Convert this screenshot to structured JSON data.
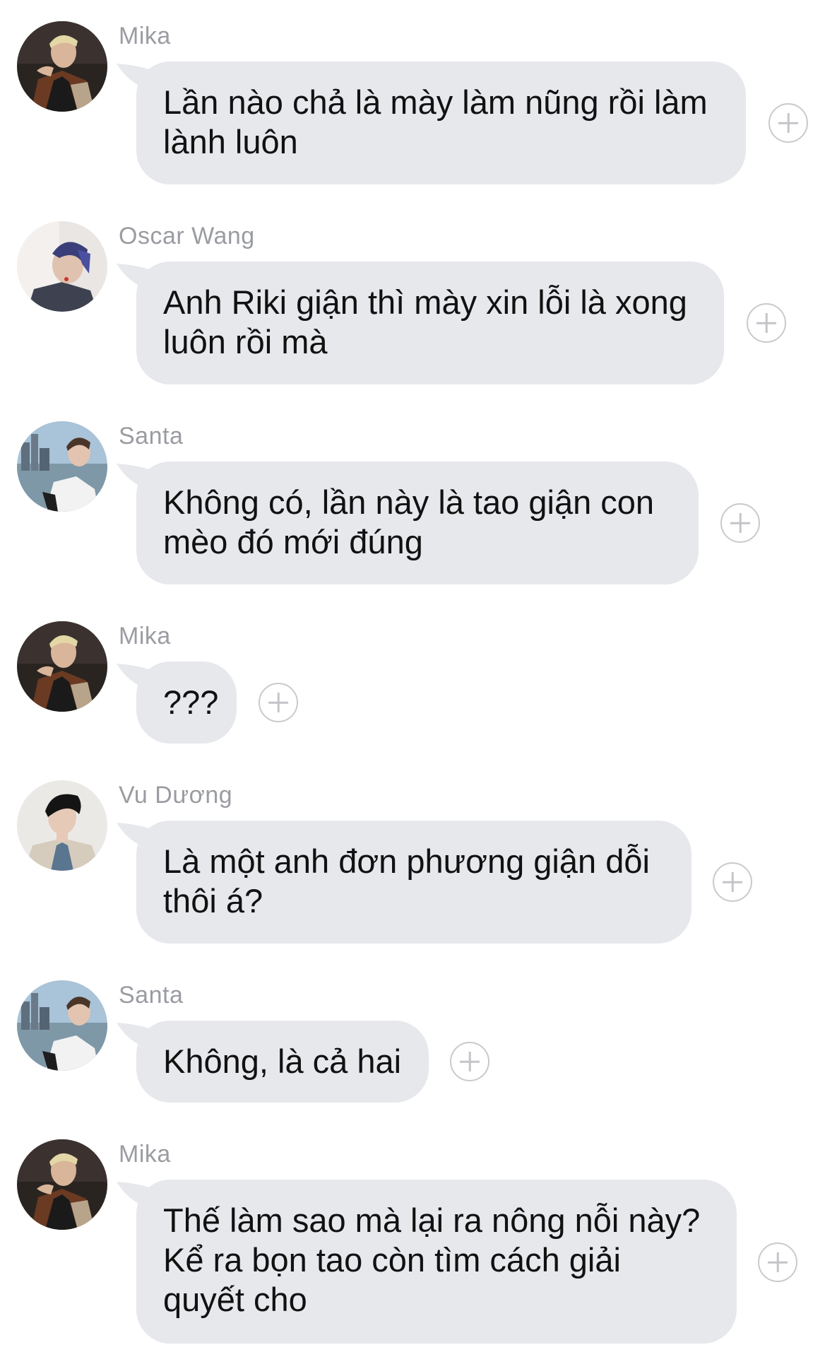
{
  "messages": [
    {
      "sender": "Mika",
      "avatar": "mika-avatar",
      "text": "Lần nào chả là mày làm nũng rồi làm\nlành luôn"
    },
    {
      "sender": "Oscar Wang",
      "avatar": "oscar-avatar",
      "text": "Anh Riki giận thì mày xin lỗi là xong\nluôn rồi mà"
    },
    {
      "sender": "Santa",
      "avatar": "santa-avatar",
      "text": "Không có, lần này là tao giận con\nmèo đó mới đúng"
    },
    {
      "sender": "Mika",
      "avatar": "mika-avatar",
      "text": "???"
    },
    {
      "sender": "Vu Dương",
      "avatar": "vu-avatar",
      "text": "Là một anh đơn phương giận dỗi\nthôi á?"
    },
    {
      "sender": "Santa",
      "avatar": "santa-avatar",
      "text": "Không, là cả hai"
    },
    {
      "sender": "Mika",
      "avatar": "mika-avatar",
      "text": "Thế làm sao mà lại ra nông nỗi này?\nKể ra bọn tao còn tìm cách giải\nquyết cho"
    }
  ],
  "icons": {
    "react": "plus-circle-icon"
  },
  "colors": {
    "bubble": "#e7e8ec",
    "sender": "#9a9ca1",
    "text": "#111111"
  }
}
